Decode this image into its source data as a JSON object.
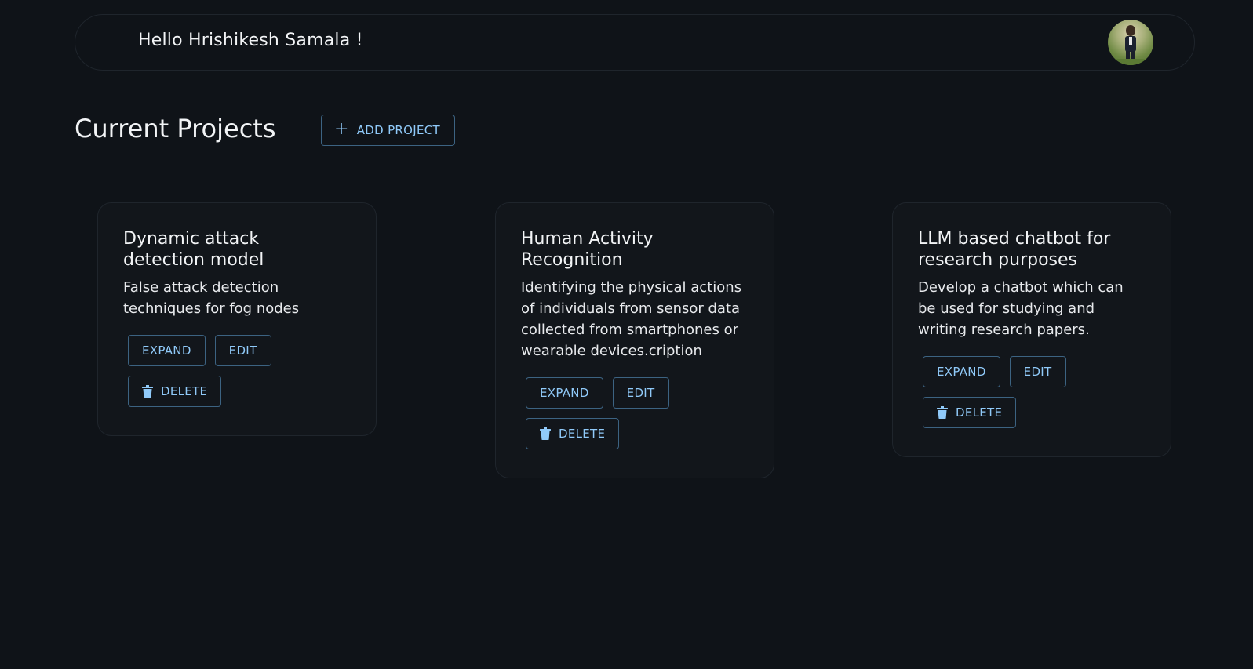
{
  "header": {
    "greeting": "Hello Hrishikesh Samala !",
    "avatar_icon": "user-photo"
  },
  "main": {
    "title": "Current Projects",
    "add_button_label": "ADD PROJECT",
    "add_icon": "plus-icon"
  },
  "projects": [
    {
      "title": "Dynamic attack detection model",
      "description": "False attack detection techniques for fog nodes",
      "expand_label": "EXPAND",
      "edit_label": "EDIT",
      "delete_label": "DELETE"
    },
    {
      "title": "Human Activity Recognition",
      "description": "Identifying the physical actions of individuals from sensor data collected from smartphones or wearable devices.cription",
      "expand_label": "EXPAND",
      "edit_label": "EDIT",
      "delete_label": "DELETE"
    },
    {
      "title": "LLM based chatbot for research purposes",
      "description": "Develop a chatbot which can be used for studying and writing research papers.",
      "expand_label": "EXPAND",
      "edit_label": "EDIT",
      "delete_label": "DELETE"
    }
  ],
  "colors": {
    "background": "#0f1318",
    "card": "#12161b",
    "accent": "#90caf9",
    "button_border": "#3c6382"
  }
}
